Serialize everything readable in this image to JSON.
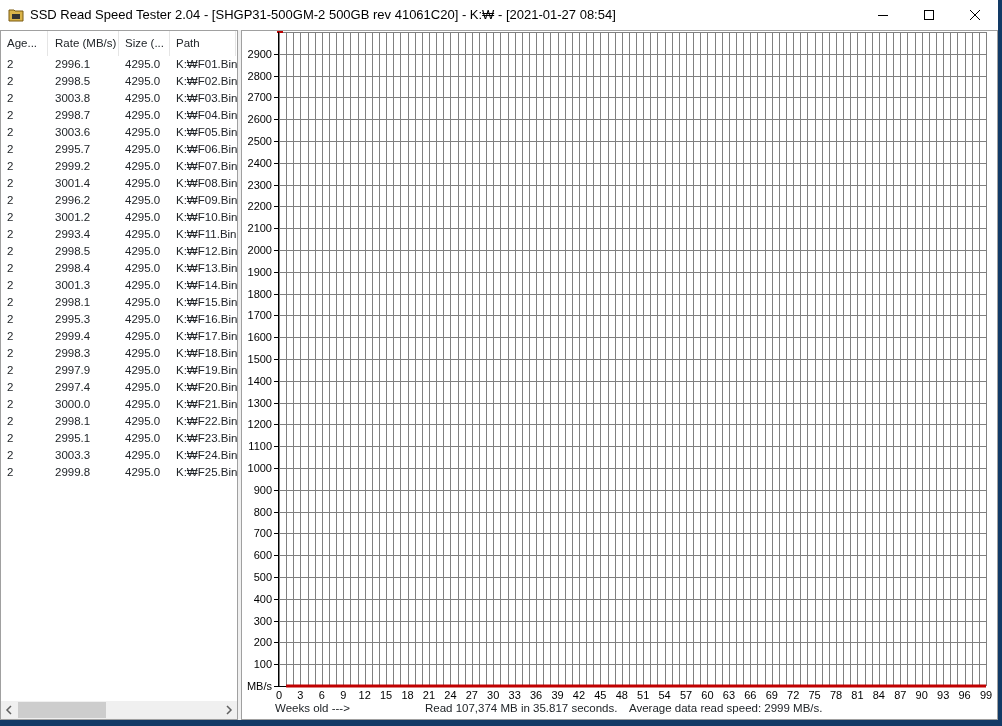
{
  "window": {
    "title": "SSD Read Speed Tester 2.04 - [SHGP31-500GM-2 500GB rev 41061C20] - K:₩ - [2021-01-27 08:54]"
  },
  "file_list": {
    "columns": [
      "Age...",
      "Rate (MB/s)",
      "Size (...",
      "Path"
    ],
    "rows": [
      [
        "2",
        "2996.1",
        "4295.0",
        "K:₩F01.Bin"
      ],
      [
        "2",
        "2998.5",
        "4295.0",
        "K:₩F02.Bin"
      ],
      [
        "2",
        "3003.8",
        "4295.0",
        "K:₩F03.Bin"
      ],
      [
        "2",
        "2998.7",
        "4295.0",
        "K:₩F04.Bin"
      ],
      [
        "2",
        "3003.6",
        "4295.0",
        "K:₩F05.Bin"
      ],
      [
        "2",
        "2995.7",
        "4295.0",
        "K:₩F06.Bin"
      ],
      [
        "2",
        "2999.2",
        "4295.0",
        "K:₩F07.Bin"
      ],
      [
        "2",
        "3001.4",
        "4295.0",
        "K:₩F08.Bin"
      ],
      [
        "2",
        "2996.2",
        "4295.0",
        "K:₩F09.Bin"
      ],
      [
        "2",
        "3001.2",
        "4295.0",
        "K:₩F10.Bin"
      ],
      [
        "2",
        "2993.4",
        "4295.0",
        "K:₩F11.Bin"
      ],
      [
        "2",
        "2998.5",
        "4295.0",
        "K:₩F12.Bin"
      ],
      [
        "2",
        "2998.4",
        "4295.0",
        "K:₩F13.Bin"
      ],
      [
        "2",
        "3001.3",
        "4295.0",
        "K:₩F14.Bin"
      ],
      [
        "2",
        "2998.1",
        "4295.0",
        "K:₩F15.Bin"
      ],
      [
        "2",
        "2995.3",
        "4295.0",
        "K:₩F16.Bin"
      ],
      [
        "2",
        "2999.4",
        "4295.0",
        "K:₩F17.Bin"
      ],
      [
        "2",
        "2998.3",
        "4295.0",
        "K:₩F18.Bin"
      ],
      [
        "2",
        "2997.9",
        "4295.0",
        "K:₩F19.Bin"
      ],
      [
        "2",
        "2997.4",
        "4295.0",
        "K:₩F20.Bin"
      ],
      [
        "2",
        "3000.0",
        "4295.0",
        "K:₩F21.Bin"
      ],
      [
        "2",
        "2998.1",
        "4295.0",
        "K:₩F22.Bin"
      ],
      [
        "2",
        "2995.1",
        "4295.0",
        "K:₩F23.Bin"
      ],
      [
        "2",
        "3003.3",
        "4295.0",
        "K:₩F24.Bin"
      ],
      [
        "2",
        "2999.8",
        "4295.0",
        "K:₩F25.Bin"
      ]
    ]
  },
  "chart": {
    "chart_data": {
      "type": "line",
      "xlabel": "Weeks old --->",
      "x": [
        1,
        99
      ],
      "grid": true,
      "series": [
        {
          "color": "#c00000",
          "values": [
            0,
            0
          ]
        }
      ],
      "xlim": [
        0,
        99
      ],
      "ylim": [
        0,
        3000
      ],
      "xticks": [
        0,
        3,
        6,
        9,
        12,
        15,
        18,
        21,
        24,
        27,
        30,
        33,
        36,
        39,
        42,
        45,
        48,
        51,
        54,
        57,
        60,
        63,
        66,
        69,
        72,
        75,
        78,
        81,
        84,
        87,
        90,
        93,
        96,
        99
      ],
      "yticks": [
        {
          "value": 0,
          "label": "MB/s"
        },
        100,
        200,
        300,
        400,
        500,
        600,
        700,
        800,
        900,
        1000,
        1100,
        1200,
        1300,
        1400,
        1500,
        1600,
        1700,
        1800,
        1900,
        2000,
        2100,
        2200,
        2300,
        2400,
        2500,
        2600,
        2700,
        2800,
        2900
      ]
    }
  },
  "status": {
    "read_summary": "Read 107,374 MB in 35.817 seconds.",
    "average_speed": "Average data read speed: 2999 MB/s."
  }
}
